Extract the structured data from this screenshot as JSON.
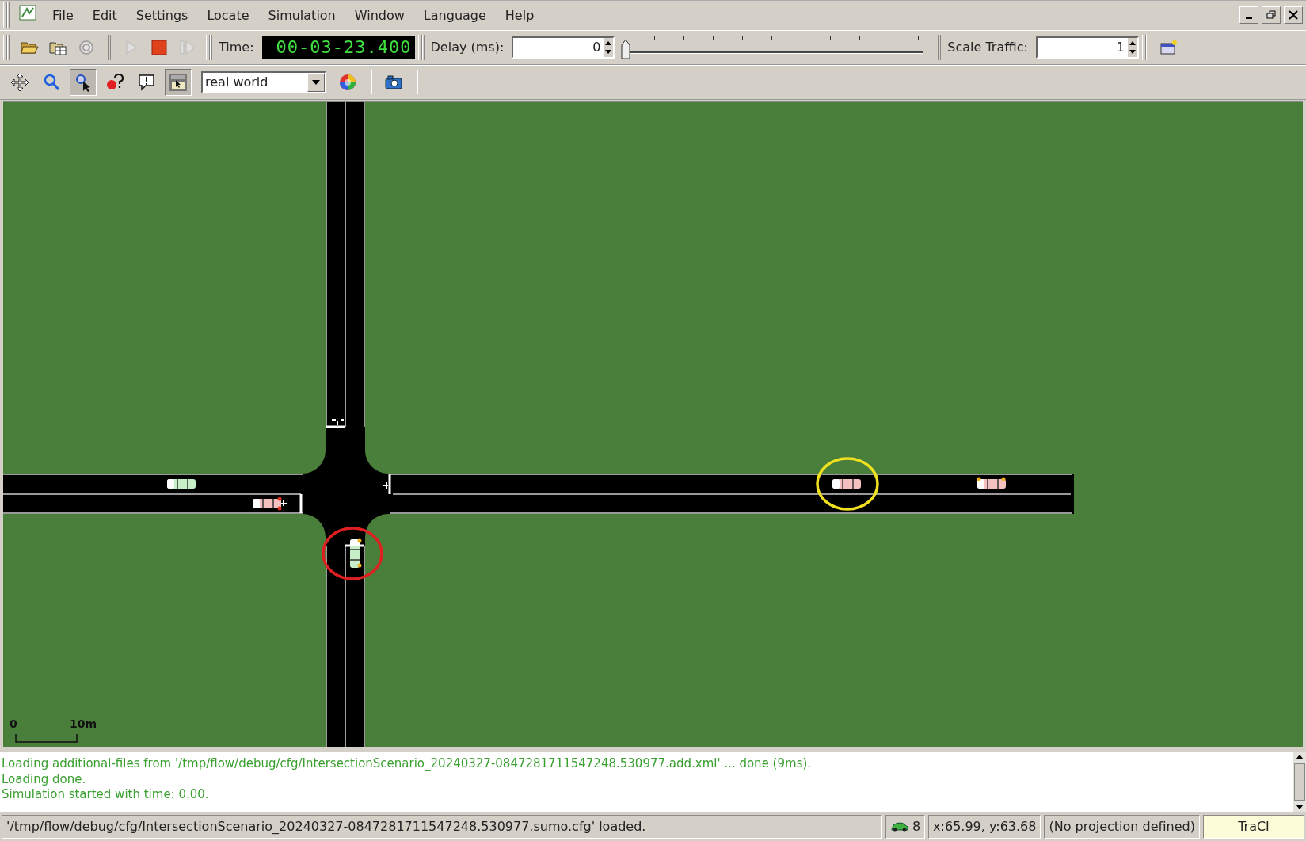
{
  "menu": [
    "File",
    "Edit",
    "Settings",
    "Locate",
    "Simulation",
    "Window",
    "Language",
    "Help"
  ],
  "toolbar": [
    {
      "kind": "open",
      "disabled": false
    },
    {
      "kind": "open-network",
      "disabled": false
    },
    {
      "kind": "reload",
      "disabled": true
    },
    {
      "kind": "play",
      "disabled": true
    },
    {
      "kind": "stop",
      "disabled": false
    },
    {
      "kind": "step",
      "disabled": true
    }
  ],
  "time": {
    "label": "Time:",
    "value": "00-03-23.400"
  },
  "delay": {
    "label": "Delay (ms):",
    "value": "0",
    "level": 0
  },
  "scale_traffic": {
    "label": "Scale Traffic:",
    "value": "1"
  },
  "view_tools": [
    {
      "kind": "recenter",
      "pressed": false
    },
    {
      "kind": "zoom",
      "pressed": false
    },
    {
      "kind": "select",
      "pressed": true
    },
    {
      "kind": "inspect",
      "pressed": false
    },
    {
      "kind": "messages",
      "pressed": false
    },
    {
      "kind": "menu",
      "pressed": true
    }
  ],
  "view_scheme": "real world",
  "scale_bar": {
    "start": "0",
    "end": "10m"
  },
  "messages": [
    "Loading additional-files from '/tmp/flow/debug/cfg/IntersectionScenario_20240327-0847281711547248.530977.add.xml' ... done (9ms).",
    "Loading done.",
    "Simulation started with time: 0.00."
  ],
  "status_bar": {
    "message": "'/tmp/flow/debug/cfg/IntersectionScenario_20240327-0847281711547248.530977.sumo.cfg' loaded.",
    "vehicle_count": "8",
    "coordinates": "x:65.99, y:63.68",
    "projection": "(No projection defined)",
    "mode": "TraCI"
  }
}
